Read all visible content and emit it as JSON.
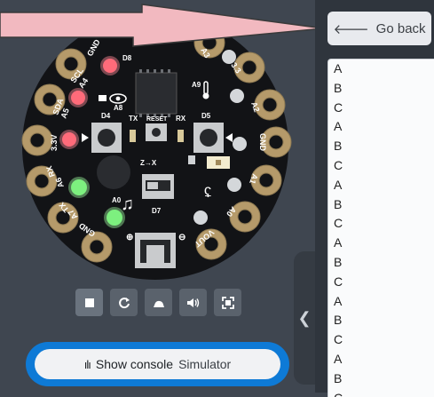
{
  "go_back": {
    "label": "Go back"
  },
  "console_output": [
    "A",
    "B",
    "C",
    "A",
    "B",
    "C",
    "A",
    "B",
    "C",
    "A",
    "B",
    "C",
    "A",
    "B",
    "C",
    "A",
    "B",
    "C"
  ],
  "board": {
    "pad_labels": {
      "gnd_top": "GND",
      "scl": "SCL",
      "a4": "A4",
      "sda": "SDA",
      "a5": "A5",
      "v33": "3.3V",
      "rx": "RX",
      "a6": "A6",
      "tx": "TX",
      "a7": "A7",
      "gnd_bottom": "GND",
      "a3": "A3",
      "v3": "3.3",
      "a2": "A2",
      "gnd_right": "GND",
      "a1": "A1",
      "a0": "A0",
      "vout": "VOUT"
    },
    "chip_labels": {
      "d8": "D8",
      "a8": "A8",
      "a9": "A9",
      "d4": "D4",
      "d5": "D5",
      "tx": "TX",
      "reset": "RESET",
      "rx": "RX",
      "a0": "A0",
      "d7": "D7",
      "xyz": "Z→X"
    }
  },
  "toolbar": [
    "stop-icon",
    "restart-icon",
    "slow-motion-icon",
    "mute-icon",
    "fullscreen-icon"
  ],
  "show_console": {
    "label": "Show console",
    "sub": "Simulator"
  },
  "colors": {
    "accent": "#0e7ad6",
    "board": "#111214",
    "pad": "#b49a6c",
    "led_red": "#ff6b7a",
    "led_green": "#7df07f",
    "pointer": "#f2b9c0"
  }
}
